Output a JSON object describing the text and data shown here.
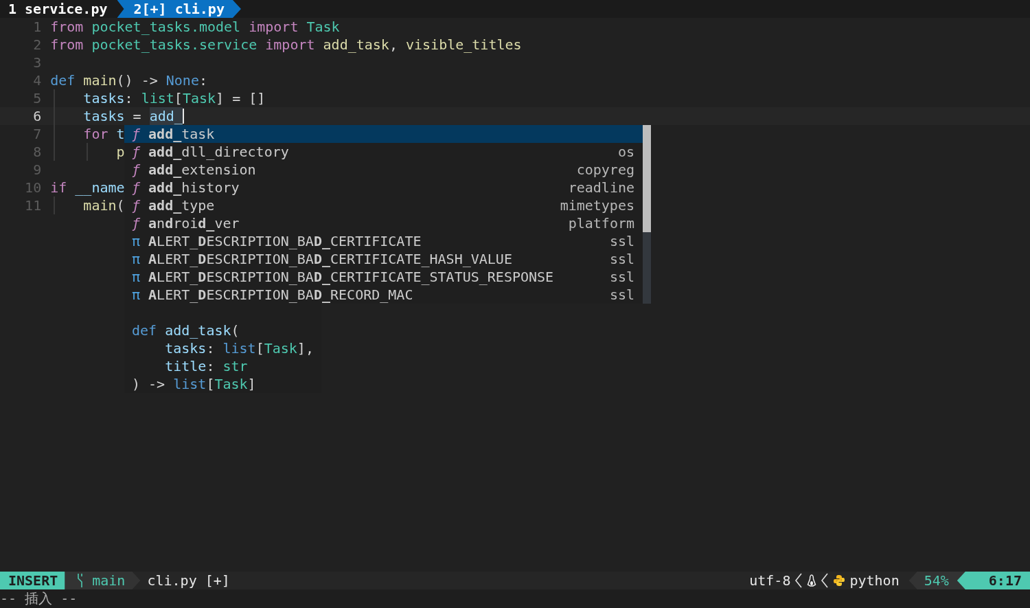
{
  "tabs": [
    {
      "label": "1 service.py",
      "selected": false
    },
    {
      "label": "2[+] cli.py",
      "selected": true
    }
  ],
  "editor": {
    "lines": [
      {
        "number": "1",
        "current": false,
        "tokens": [
          {
            "text": "from ",
            "kind": "keyword"
          },
          {
            "text": "pocket_tasks.model ",
            "kind": "module"
          },
          {
            "text": "import ",
            "kind": "keyword"
          },
          {
            "text": "Task",
            "kind": "type"
          }
        ]
      },
      {
        "number": "2",
        "current": false,
        "tokens": [
          {
            "text": "from ",
            "kind": "keyword"
          },
          {
            "text": "pocket_tasks.service ",
            "kind": "module"
          },
          {
            "text": "import ",
            "kind": "keyword"
          },
          {
            "text": "add_task",
            "kind": "func"
          },
          {
            "text": ", ",
            "kind": "plain"
          },
          {
            "text": "visible_titles",
            "kind": "func"
          }
        ]
      },
      {
        "number": "3",
        "current": false
      },
      {
        "number": "4",
        "current": false,
        "tokens": [
          {
            "text": "def ",
            "kind": "storage"
          },
          {
            "text": "main",
            "kind": "func"
          },
          {
            "text": "() -> ",
            "kind": "plain"
          },
          {
            "text": "None",
            "kind": "storage"
          },
          {
            "text": ":",
            "kind": "plain"
          }
        ],
        "children": [
          {
            "number": "5",
            "current": false,
            "tokens": [
              {
                "text": "tasks",
                "kind": "var"
              },
              {
                "text": ": ",
                "kind": "plain"
              },
              {
                "text": "list",
                "kind": "type"
              },
              {
                "text": "[",
                "kind": "plain"
              },
              {
                "text": "Task",
                "kind": "type"
              },
              {
                "text": "] = []",
                "kind": "plain"
              }
            ]
          },
          {
            "number": "6",
            "current": true,
            "tokens": [
              {
                "text": "tasks",
                "kind": "var"
              },
              {
                "text": " = ",
                "kind": "plain"
              },
              {
                "text": "add_",
                "kind": "typed"
              }
            ]
          },
          {
            "number": "7",
            "current": false,
            "tokens": [
              {
                "text": "for ",
                "kind": "keyword"
              },
              {
                "text": "t",
                "kind": "var"
              }
            ],
            "children": [
              {
                "number": "8",
                "current": false,
                "tokens": [
                  {
                    "text": "p",
                    "kind": "func"
                  }
                ]
              }
            ]
          }
        ]
      },
      {
        "number": "9",
        "current": false
      },
      {
        "number": "10",
        "current": false,
        "tokens": [
          {
            "text": "if ",
            "kind": "keyword"
          },
          {
            "text": "__name",
            "kind": "var"
          }
        ],
        "children": [
          {
            "number": "11",
            "current": false,
            "tokens": [
              {
                "text": "main",
                "kind": "func"
              },
              {
                "text": "(",
                "kind": "plain"
              }
            ]
          }
        ]
      }
    ]
  },
  "completion": {
    "items": [
      {
        "kind": "function",
        "icon": "ƒ",
        "label": "**add_**task",
        "selected": true
      },
      {
        "kind": "function",
        "icon": "ƒ",
        "label": "**add_**dll_directory",
        "source": "os",
        "selected": false
      },
      {
        "kind": "function",
        "icon": "ƒ",
        "label": "**add_**extension",
        "source": "copyreg",
        "selected": false
      },
      {
        "kind": "function",
        "icon": "ƒ",
        "label": "**add_**history",
        "source": "readline",
        "selected": false
      },
      {
        "kind": "function",
        "icon": "ƒ",
        "label": "**add_**type",
        "source": "mimetypes",
        "selected": false
      },
      {
        "kind": "function",
        "icon": "ƒ",
        "label": "**a**n**d**roi**d_**ver",
        "source": "platform",
        "selected": false
      },
      {
        "kind": "constant",
        "icon": "π",
        "label": "**A**LERT_**D**ESCRIPTION_BA**D_**CERTIFICATE",
        "source": "ssl",
        "selected": false
      },
      {
        "kind": "constant",
        "icon": "π",
        "label": "**A**LERT_**D**ESCRIPTION_BA**D_**CERTIFICATE_HASH_VALUE",
        "source": "ssl",
        "selected": false
      },
      {
        "kind": "constant",
        "icon": "π",
        "label": "**A**LERT_**D**ESCRIPTION_BA**D_**CERTIFICATE_STATUS_RESPONSE",
        "source": "ssl",
        "selected": false
      },
      {
        "kind": "constant",
        "icon": "π",
        "label": "**A**LERT_**D**ESCRIPTION_BA**D_**RECORD_MAC",
        "source": "ssl",
        "selected": false
      }
    ],
    "documentation": [
      {
        "tokens": [
          {
            "text": "def ",
            "kind": "storage"
          },
          {
            "text": "add_task",
            "kind": "var"
          },
          {
            "text": "(",
            "kind": "plain"
          }
        ],
        "children": [
          {
            "tokens": [
              {
                "text": "tasks",
                "kind": "var"
              },
              {
                "text": ": ",
                "kind": "plain"
              },
              {
                "text": "list",
                "kind": "storage"
              },
              {
                "text": "[",
                "kind": "plain"
              },
              {
                "text": "Task",
                "kind": "type"
              },
              {
                "text": "],",
                "kind": "plain"
              }
            ]
          },
          {
            "tokens": [
              {
                "text": "title",
                "kind": "var"
              },
              {
                "text": ": ",
                "kind": "plain"
              },
              {
                "text": "str",
                "kind": "type"
              }
            ]
          }
        ]
      },
      {
        "tokens": [
          {
            "text": ") -> ",
            "kind": "plain"
          },
          {
            "text": "list",
            "kind": "storage"
          },
          {
            "text": "[",
            "kind": "plain"
          },
          {
            "text": "Task",
            "kind": "type"
          },
          {
            "text": "]",
            "kind": "plain"
          }
        ]
      }
    ]
  },
  "status_bar": {
    "mode": "INSERT",
    "branch": "main",
    "file": "cli.py [+]",
    "encoding": "utf-8",
    "filetype": "python",
    "percent": "54%",
    "position": "6:17"
  },
  "message": "-- 插入 --"
}
